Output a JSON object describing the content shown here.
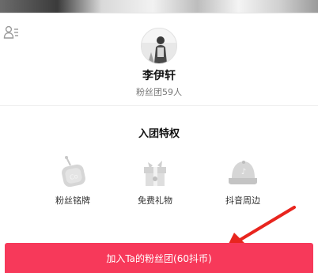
{
  "profile": {
    "name": "李伊轩",
    "fans_label": "粉丝团59人"
  },
  "privileges": {
    "title": "入团特权",
    "items": [
      {
        "icon": "fan-badge-icon",
        "label": "粉丝铭牌"
      },
      {
        "icon": "gift-icon",
        "label": "免费礼物"
      },
      {
        "icon": "douyin-cap-icon",
        "label": "抖音周边"
      }
    ]
  },
  "join": {
    "label": "加入Ta的粉丝团(60抖币)"
  },
  "colors": {
    "accent": "#f7395a",
    "annotation_arrow": "#e8251e"
  }
}
